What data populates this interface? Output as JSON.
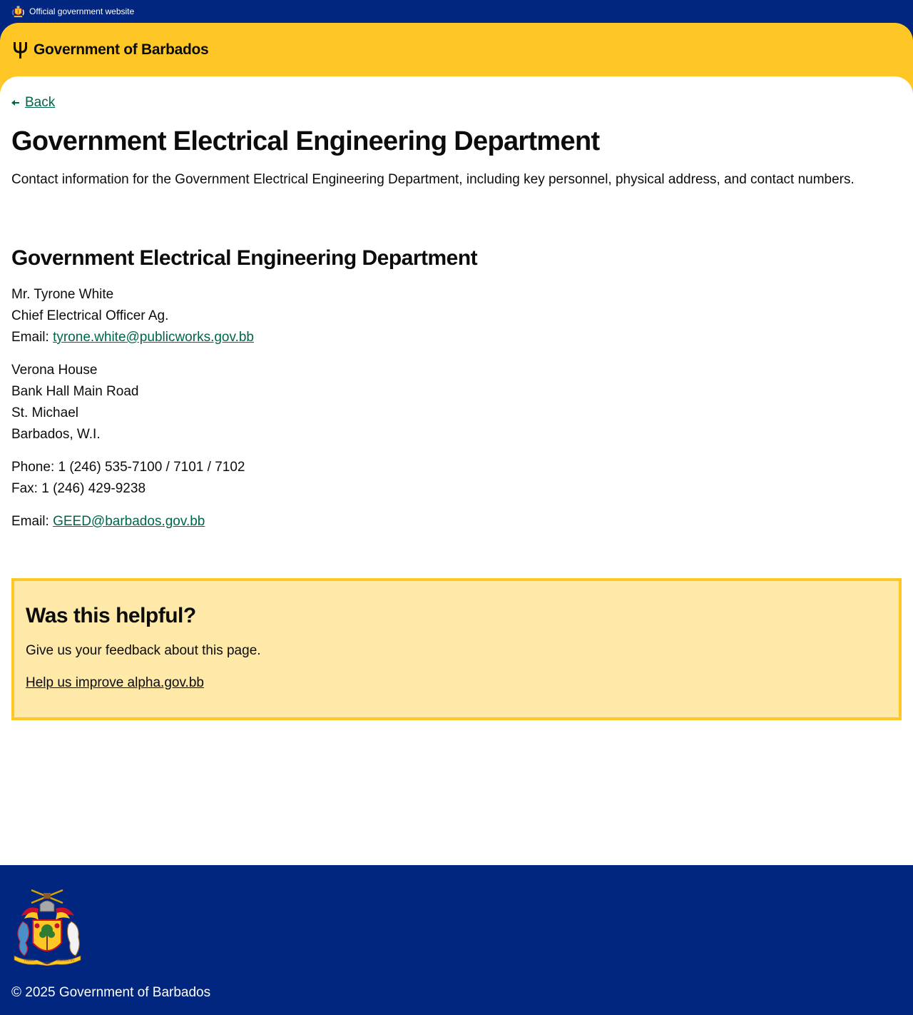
{
  "official_banner": {
    "text": "Official government website",
    "icon": "coat-of-arms-icon"
  },
  "header": {
    "brand": "Government of Barbados",
    "icon": "trident-icon"
  },
  "back_link": {
    "label": "Back",
    "icon": "arrow-left-icon"
  },
  "page": {
    "title": "Government Electrical Engineering Department",
    "lead": "Contact information for the Government Electrical Engineering Department, including key personnel, physical address, and contact numbers."
  },
  "section": {
    "heading": "Government Electrical Engineering Department",
    "person": {
      "name": "Mr. Tyrone White",
      "role": "Chief Electrical Officer Ag.",
      "email_label": "Email: ",
      "email": "tyrone.white@publicworks.gov.bb"
    },
    "address": [
      "Verona House",
      "Bank Hall Main Road",
      "St. Michael",
      "Barbados, W.I."
    ],
    "phone": "Phone: 1 (246) 535-7100 / 7101 / 7102",
    "fax": "Fax: 1 (246) 429-9238",
    "general_email_label": "Email: ",
    "general_email": "GEED@barbados.gov.bb"
  },
  "feedback": {
    "heading": "Was this helpful?",
    "text": "Give us your feedback about this page.",
    "link": "Help us improve alpha.gov.bb"
  },
  "footer": {
    "copyright": "© 2025 Government of Barbados",
    "crest_icon": "coat-of-arms-icon",
    "crest_motto": [
      "PRIDE",
      "AND",
      "INDUSTRY"
    ]
  },
  "colors": {
    "navy": "#00267f",
    "gold": "#ffc726",
    "link_green": "#00654a",
    "feedback_bg": "#ffe9a8"
  }
}
